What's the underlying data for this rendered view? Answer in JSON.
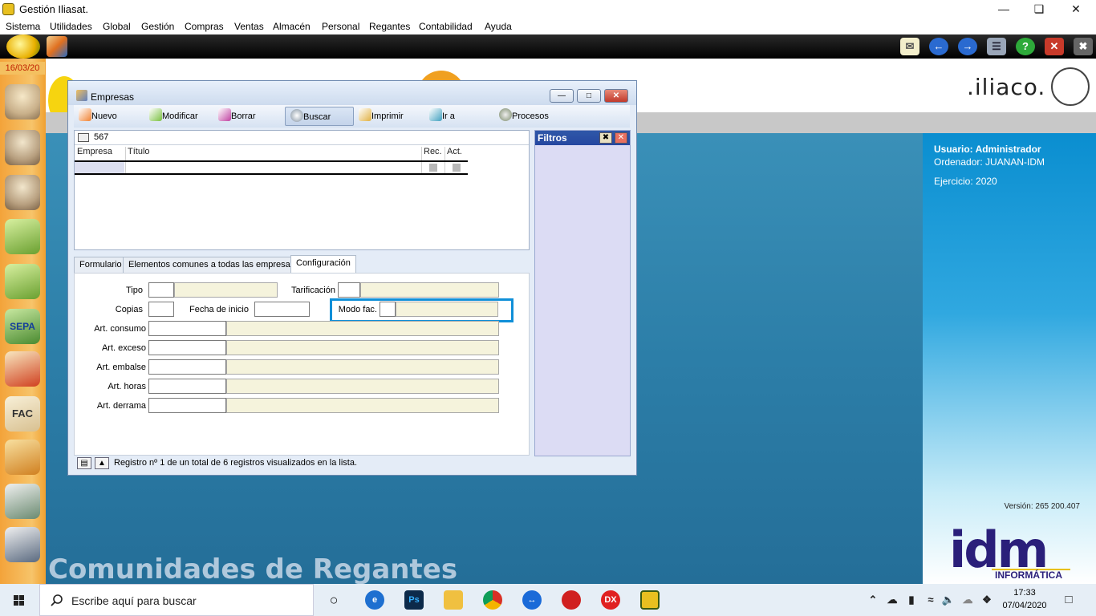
{
  "window": {
    "title": "Gestión Iliasat."
  },
  "menu": [
    "Sistema",
    "Utilidades",
    "Global",
    "Gestión",
    "Compras",
    "Ventas",
    "Almacén",
    "Personal",
    "Regantes",
    "Contabilidad",
    "Ayuda"
  ],
  "sidebar": {
    "date": "16/03/20"
  },
  "brand": {
    "logo": ".iliaco.",
    "idm": "idm",
    "idm_sub": "INFORMÁTICA",
    "background_text": "Comunidades de Regantes"
  },
  "info": {
    "user": "Usuario: Administrador",
    "computer": "Ordenador: JUANAN-IDM",
    "year": "Ejercicio: 2020",
    "version": "Versión: 265 200.407"
  },
  "empresas": {
    "title": "Empresas",
    "toolbar": {
      "nuevo": "Nuevo",
      "modificar": "Modificar",
      "borrar": "Borrar",
      "buscar": "Buscar",
      "imprimir": "Imprimir",
      "ir_a": "Ir a",
      "procesos": "Procesos"
    },
    "search_value": "567",
    "columns": {
      "empresa": "Empresa",
      "titulo": "Título",
      "rec": "Rec.",
      "act": "Act."
    },
    "filters_title": "Filtros",
    "tabs": {
      "formulario": "Formulario",
      "comunes": "Elementos comunes a todas las empresas",
      "configuracion": "Configuración"
    },
    "form": {
      "tipo": "Tipo",
      "tarificacion": "Tarificación",
      "copias": "Copias",
      "fecha_inicio": "Fecha de inicio",
      "modo_fac": "Modo fac.",
      "art_consumo": "Art. consumo",
      "art_exceso": "Art. exceso",
      "art_embalse": "Art. embalse",
      "art_horas": "Art. horas",
      "art_derrama": "Art. derrama"
    },
    "status": "Registro nº 1 de un total de 6 registros visualizados en la lista."
  },
  "taskbar": {
    "search_placeholder": "Escribe aquí para buscar",
    "time": "17:33",
    "date": "07/04/2020",
    "dx_label": "DX",
    "ps_label": "Ps"
  },
  "colors": {
    "accent_blue": "#0f8fd8",
    "field_tint": "#f5f3dc",
    "filter_header": "#2f57a8"
  }
}
